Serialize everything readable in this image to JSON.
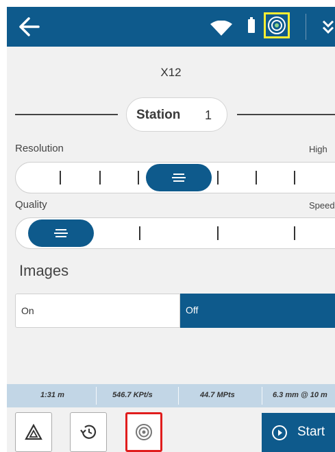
{
  "header": {
    "back_icon": "arrow-left-icon",
    "wifi_icon": "wifi-icon",
    "battery_icon": "battery-icon",
    "scan_status_icon": "scanner-target-icon",
    "more_icon": "chevron-double-down-icon",
    "highlight_color": "#ffee33"
  },
  "device": {
    "name": "X12"
  },
  "station": {
    "label": "Station",
    "number": "1"
  },
  "resolution": {
    "label": "Resolution",
    "max_label": "High",
    "steps": 7,
    "selected_step": 3
  },
  "quality": {
    "label": "Quality",
    "max_label": "Speed",
    "steps": 4,
    "selected_step": 0
  },
  "images": {
    "title": "Images",
    "on_label": "On",
    "off_label": "Off",
    "selected": "Off"
  },
  "status_strip": {
    "duration": "1:31 m",
    "point_rate": "546.7 KPt/s",
    "points": "44.7 MPts",
    "spacing": "6.3 mm @ 10 m"
  },
  "toolbar": {
    "tools": [
      {
        "icon": "target-triangle-icon",
        "active": false
      },
      {
        "icon": "history-icon",
        "active": false
      },
      {
        "icon": "scan-target-icon",
        "active": true
      }
    ],
    "start_label": "Start",
    "start_icon": "play-circle-icon",
    "active_color": "#e01d1d"
  },
  "colors": {
    "brand": "#0e5a8c",
    "status_strip": "#c2d6e6",
    "background": "#f1f1f1"
  }
}
